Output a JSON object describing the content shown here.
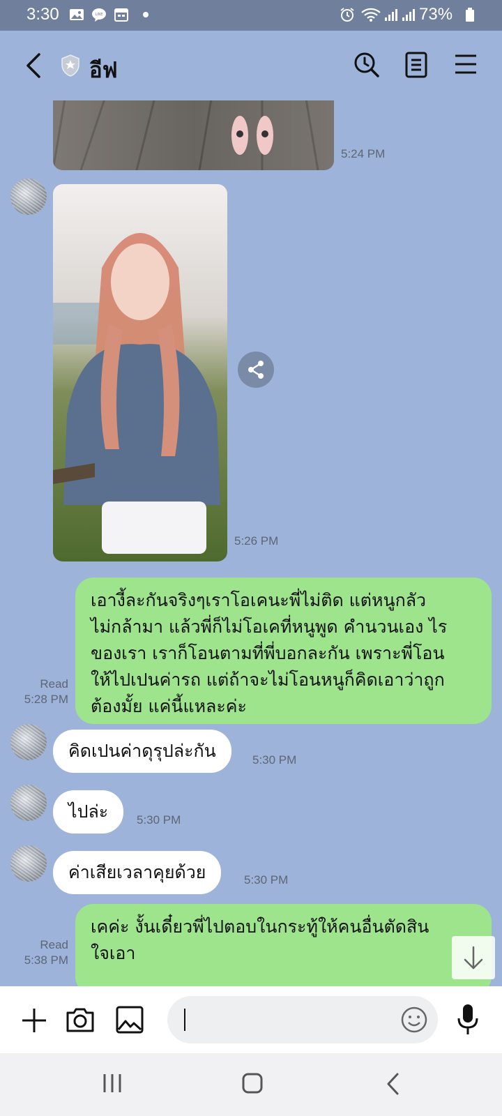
{
  "status_bar": {
    "time": "3:30",
    "battery": "73%",
    "icons": [
      "gallery-icon",
      "line-app-icon",
      "calendar-icon",
      "dot-icon",
      "alarm-icon",
      "wifi-icon",
      "signal-icon",
      "signal-icon",
      "battery-icon"
    ]
  },
  "header": {
    "title": "อีฟ",
    "icons": [
      "back-arrow-icon",
      "shield-star-icon",
      "search-clock-icon",
      "notes-icon",
      "menu-icon"
    ]
  },
  "messages": [
    {
      "type": "image",
      "side": "in",
      "time": "5:24 PM"
    },
    {
      "type": "image",
      "side": "in",
      "time": "5:26 PM"
    },
    {
      "type": "text",
      "side": "out",
      "read": "Read",
      "time": "5:28 PM",
      "lines": [
        "เอางี้ละกันจริงๆเราโอเคนะพี่ไม่ติด แต่หนูกลัว",
        "ไม่กล้ามา แล้วพี่ก็ไม่โอเคที่หนูพูด คำนวนเอง ไร",
        "ของเรา เราก็โอนตามที่พี่บอกละกัน เพราะพี่โอน",
        "ให้ไปเปนค่ารถ แต่ถ้าจะไม่โอนหนูก็คิดเอาว่าถูก",
        "ต้องมั้ย แค่นี้แหละค่ะ"
      ]
    },
    {
      "type": "text",
      "side": "in",
      "time": "5:30 PM",
      "text": "คิดเปนค่าดุรุปล่ะกัน"
    },
    {
      "type": "text",
      "side": "in",
      "time": "5:30 PM",
      "text": "ไปล่ะ"
    },
    {
      "type": "text",
      "side": "in",
      "time": "5:30 PM",
      "text": "ค่าเสียเวลาคุยด้วย"
    },
    {
      "type": "text",
      "side": "out",
      "read": "Read",
      "time": "5:38 PM",
      "lines": [
        "เคค่ะ งั้นเดี๋ยวพี่ไปตอบในกระทู้ให้คนอื่นตัดสิน",
        "ใจเอา"
      ]
    }
  ],
  "input_bar": {
    "placeholder": "",
    "icons": [
      "plus-icon",
      "camera-icon",
      "image-icon",
      "emoji-icon",
      "microphone-icon"
    ]
  },
  "nav_bar": {
    "icons": [
      "recent-apps-icon",
      "home-icon",
      "back-icon"
    ]
  },
  "colors": {
    "chat_background": "#9eb3da",
    "outgoing_bubble": "#9ee48c",
    "incoming_bubble": "#ffffff",
    "status_bar": "#6f7f9c"
  }
}
